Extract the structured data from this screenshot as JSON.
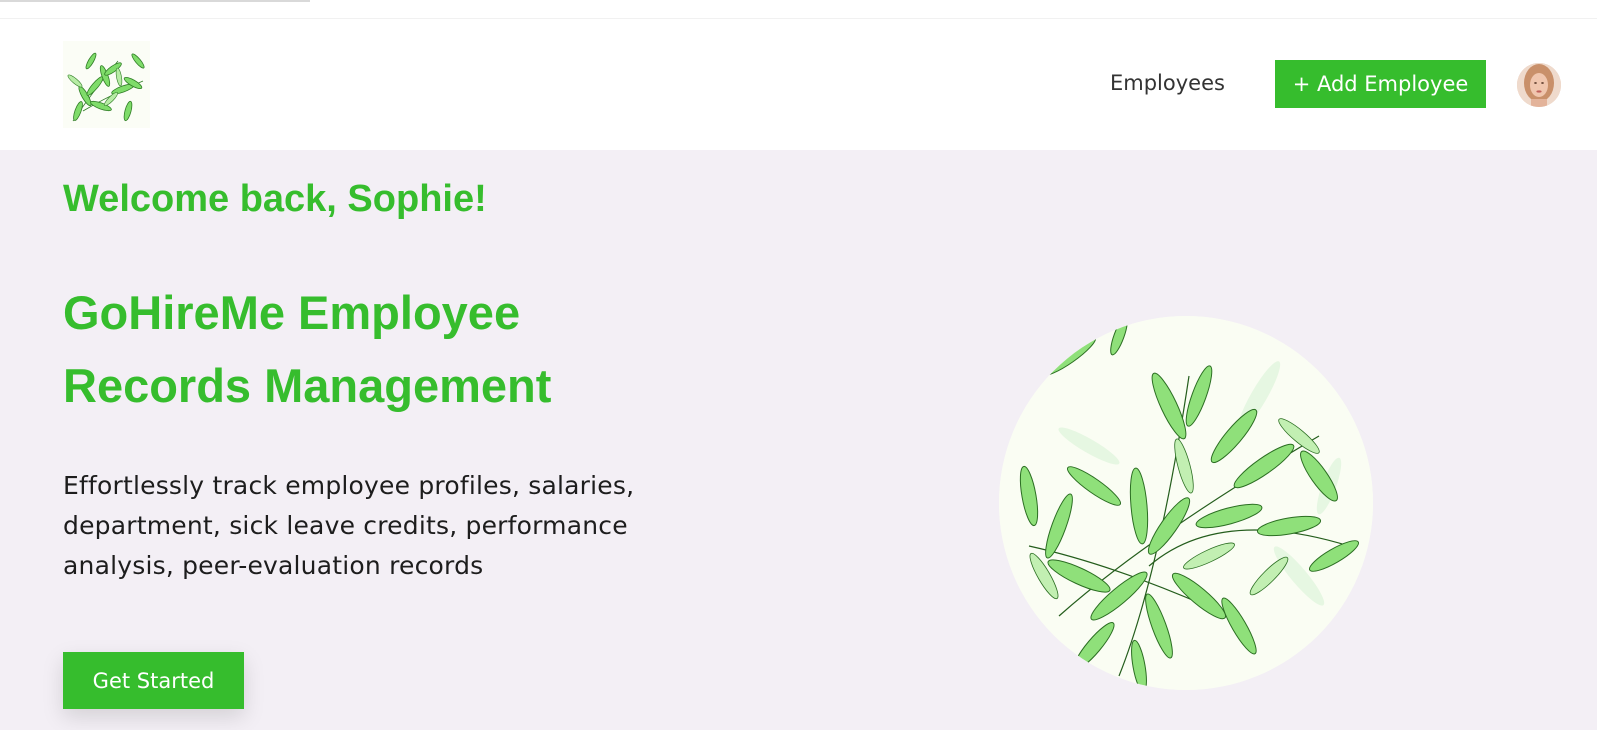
{
  "header": {
    "logo_icon": "bamboo-leaves-logo",
    "nav": {
      "employees_label": "Employees"
    },
    "add_employee_label": "+ Add Employee",
    "avatar_icon": "user-avatar"
  },
  "hero": {
    "welcome": "Welcome back, Sophie!",
    "title_line1": "GoHireMe Employee",
    "title_line2": "Records Management",
    "description": "Effortlessly track employee profiles, salaries, department, sick leave credits, performance analysis, peer-evaluation records",
    "cta_label": "Get Started",
    "image_icon": "bamboo-leaves-illustration"
  },
  "colors": {
    "accent": "#36bd2d",
    "page_bg": "#f3eff5",
    "header_bg": "#ffffff",
    "text": "#1d1d1d"
  }
}
